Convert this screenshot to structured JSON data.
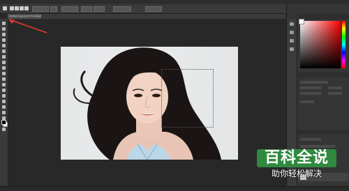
{
  "document_tab": {
    "title": "Untitled-1.jpg @ 66.7% (RGB/8#) *"
  },
  "watermark": {
    "title": "百科全说",
    "subtitle": "助你轻松解决"
  },
  "colors": {
    "accent_arrow": "#e53b2c",
    "watermark_green": "#2f8a3f"
  },
  "icons": [
    "move-icon",
    "marquee-icon",
    "lasso-icon",
    "magic-wand-icon",
    "crop-icon",
    "eyedropper-icon",
    "healing-icon",
    "brush-icon",
    "stamp-icon",
    "history-brush-icon",
    "eraser-icon",
    "gradient-icon",
    "blur-icon",
    "dodge-icon",
    "pen-icon",
    "text-icon",
    "path-select-icon",
    "shape-icon",
    "hand-icon",
    "zoom-icon"
  ]
}
